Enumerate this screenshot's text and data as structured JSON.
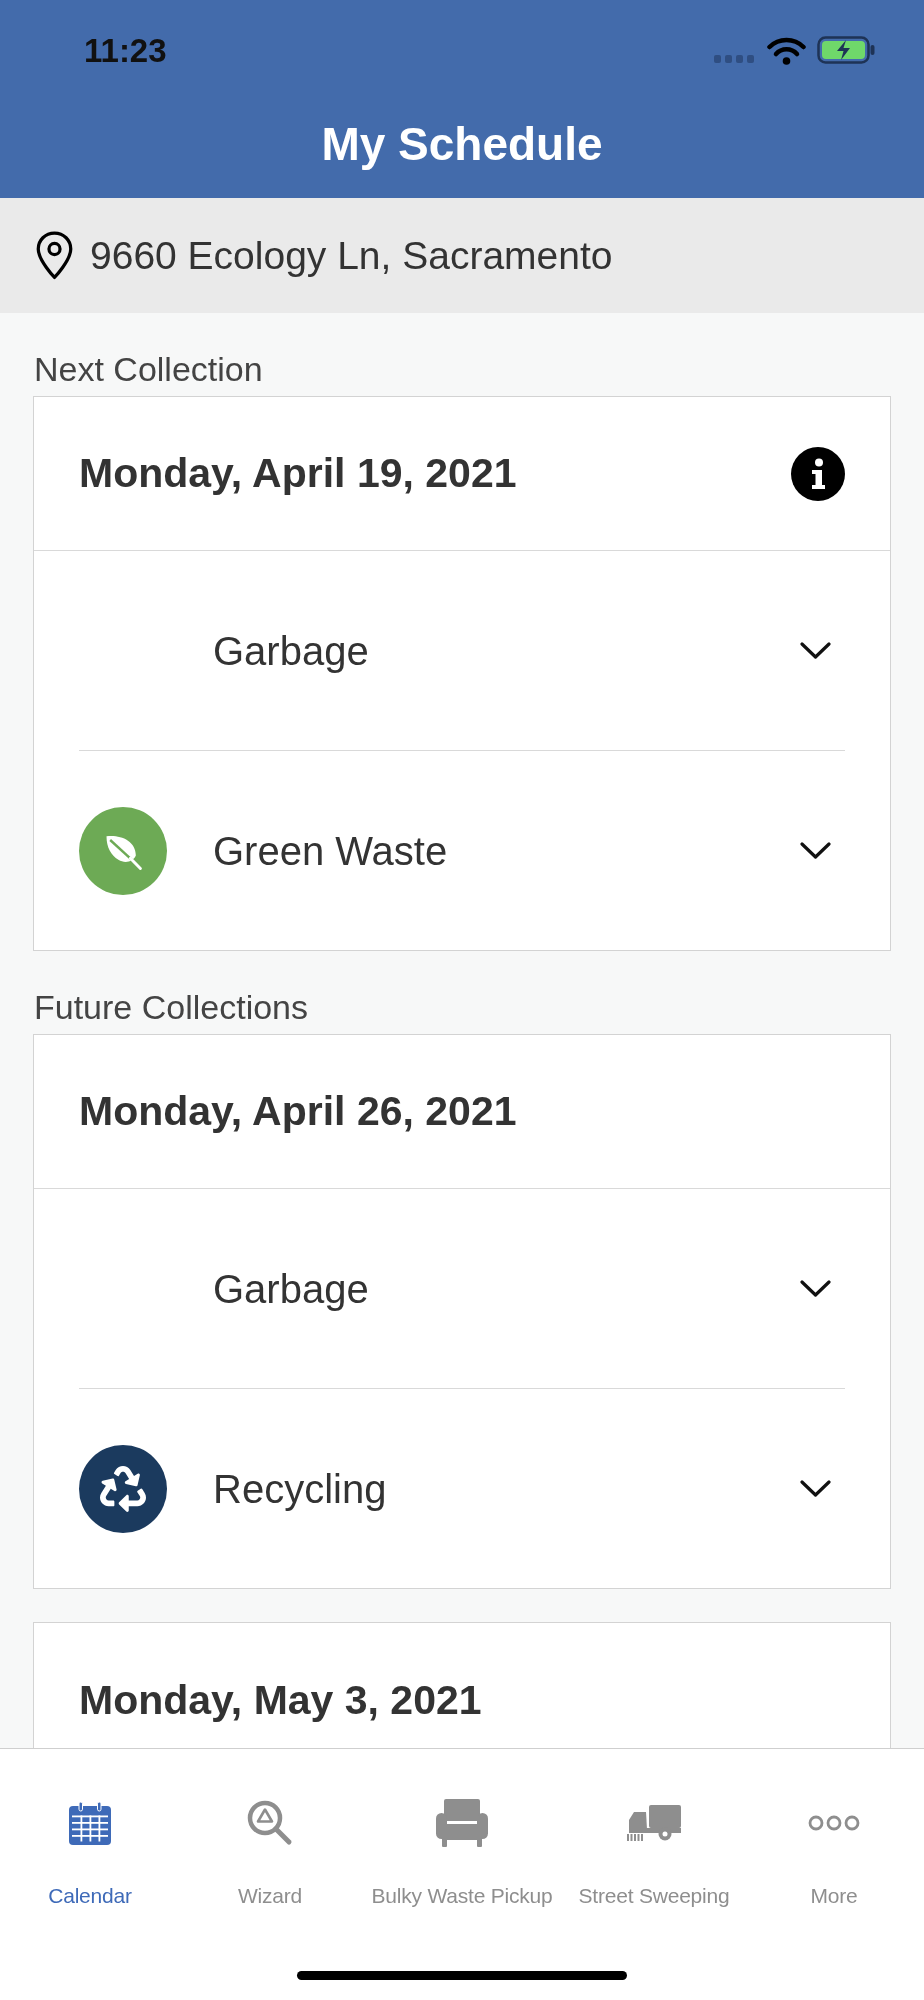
{
  "status_bar": {
    "time": "11:23"
  },
  "header": {
    "title": "My Schedule"
  },
  "address_bar": {
    "address": "9660 Ecology Ln, Sacramento"
  },
  "sections": [
    {
      "label": "Next Collection",
      "cards": [
        {
          "date": "Monday, April 19, 2021",
          "info": true,
          "items": [
            {
              "name": "Garbage",
              "kind": "plain",
              "expanded": false
            },
            {
              "name": "Green Waste",
              "kind": "leaf",
              "color": "#6daa55",
              "expanded": false
            }
          ]
        }
      ]
    },
    {
      "label": "Future Collections",
      "cards": [
        {
          "date": "Monday, April 26, 2021",
          "info": false,
          "items": [
            {
              "name": "Garbage",
              "kind": "plain",
              "expanded": false
            },
            {
              "name": "Recycling",
              "kind": "recycle",
              "color": "#1b3a5e",
              "expanded": false
            }
          ]
        },
        {
          "date": "Monday, May 3, 2021",
          "info": false
        }
      ]
    }
  ],
  "tab_bar": {
    "tabs": [
      {
        "label": "Calendar",
        "kind": "calendar",
        "selected": true
      },
      {
        "label": "Wizard",
        "kind": "wizard",
        "selected": false
      },
      {
        "label": "Bulky Waste Pickup",
        "kind": "bulky",
        "selected": false
      },
      {
        "label": "Street Sweeping",
        "kind": "sweeping",
        "selected": false
      },
      {
        "label": "More",
        "kind": "more",
        "selected": false
      }
    ]
  }
}
